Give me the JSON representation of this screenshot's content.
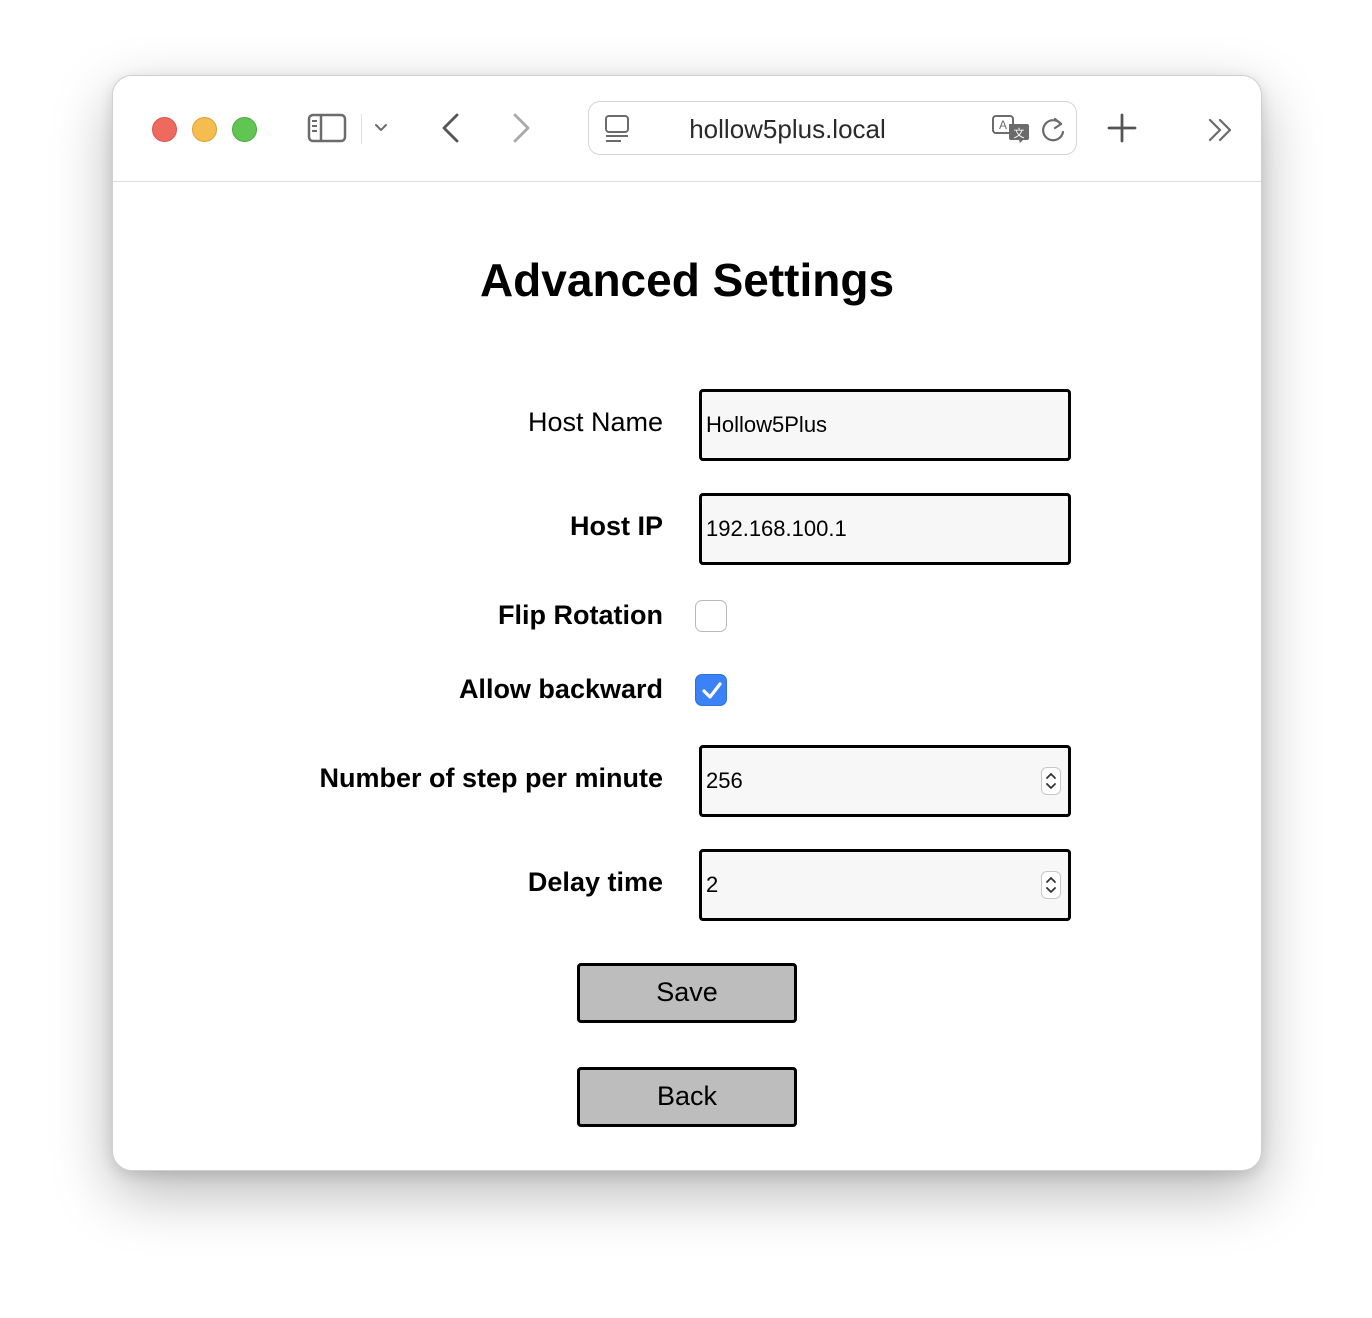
{
  "browser": {
    "url": "hollow5plus.local"
  },
  "page": {
    "title": "Advanced Settings"
  },
  "form": {
    "host_name": {
      "label": "Host Name",
      "value": "Hollow5Plus"
    },
    "host_ip": {
      "label": "Host IP",
      "value": "192.168.100.1"
    },
    "flip_rotation": {
      "label": "Flip Rotation",
      "checked": false
    },
    "allow_backward": {
      "label": "Allow backward",
      "checked": true
    },
    "steps_per_minute": {
      "label": "Number of step per minute",
      "value": "256"
    },
    "delay_time": {
      "label": "Delay time",
      "value": "2"
    }
  },
  "buttons": {
    "save": "Save",
    "back": "Back"
  },
  "colors": {
    "checkbox_checked": "#3b82f6",
    "button_bg": "#bdbdbd"
  }
}
